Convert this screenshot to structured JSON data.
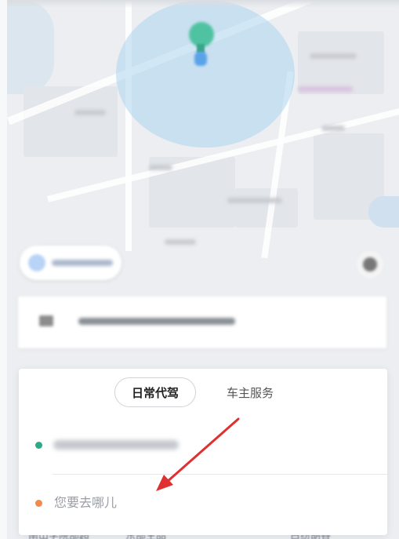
{
  "booking_panel": {
    "tabs": [
      {
        "label": "日常代驾",
        "active": true
      },
      {
        "label": "车主服务",
        "active": false
      }
    ],
    "pickup": {
      "value_obscured": true
    },
    "destination": {
      "placeholder": "您要去哪儿"
    }
  },
  "map": {
    "bottom_labels": [
      "南山学院部超",
      "东部生品",
      "白纷胡各"
    ]
  },
  "annotation": {
    "type": "arrow",
    "color": "#e03030"
  },
  "colors": {
    "pickup_dot": "#2ea886",
    "destination_dot": "#f28a4b",
    "pin": "#4fc3a1",
    "radius_circle": "#add6f0"
  }
}
